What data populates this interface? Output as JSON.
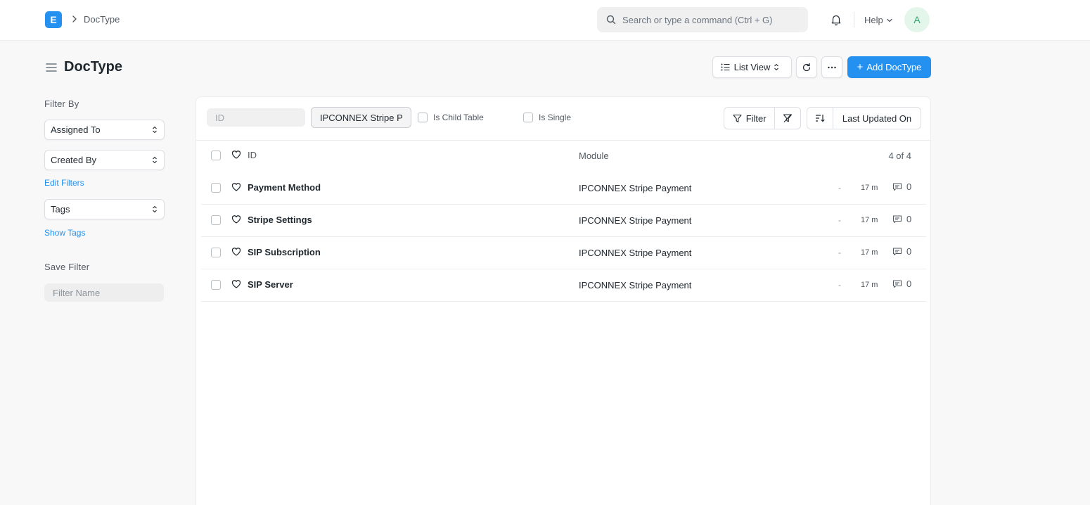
{
  "navbar": {
    "logo_letter": "E",
    "breadcrumb": "DocType",
    "search_placeholder": "Search or type a command (Ctrl + G)",
    "help_label": "Help",
    "avatar_initial": "A"
  },
  "page": {
    "title": "DocType",
    "list_view_label": "List View",
    "add_button_label": "Add DocType"
  },
  "sidebar": {
    "filter_by_label": "Filter By",
    "assigned_to": "Assigned To",
    "created_by": "Created By",
    "edit_filters": "Edit Filters",
    "tags": "Tags",
    "show_tags": "Show Tags",
    "save_filter_label": "Save Filter",
    "filter_name_placeholder": "Filter Name"
  },
  "filters": {
    "id_placeholder": "ID",
    "module_value": "IPCONNEX Stripe P",
    "is_child_table": "Is Child Table",
    "is_single": "Is Single",
    "filter_label": "Filter",
    "sort_label": "Last Updated On"
  },
  "list": {
    "header": {
      "id": "ID",
      "module": "Module",
      "count": "4 of 4"
    },
    "rows": [
      {
        "name": "Payment Method",
        "module": "IPCONNEX Stripe Payment",
        "status": "-",
        "time": "17 m",
        "comments": "0"
      },
      {
        "name": "Stripe Settings",
        "module": "IPCONNEX Stripe Payment",
        "status": "-",
        "time": "17 m",
        "comments": "0"
      },
      {
        "name": "SIP Subscription",
        "module": "IPCONNEX Stripe Payment",
        "status": "-",
        "time": "17 m",
        "comments": "0"
      },
      {
        "name": "SIP Server",
        "module": "IPCONNEX Stripe Payment",
        "status": "-",
        "time": "17 m",
        "comments": "0"
      }
    ]
  },
  "colors": {
    "primary": "#2490ef",
    "background": "#f8f8f8",
    "avatar_bg": "#e4f5e9",
    "avatar_fg": "#30a66d"
  }
}
